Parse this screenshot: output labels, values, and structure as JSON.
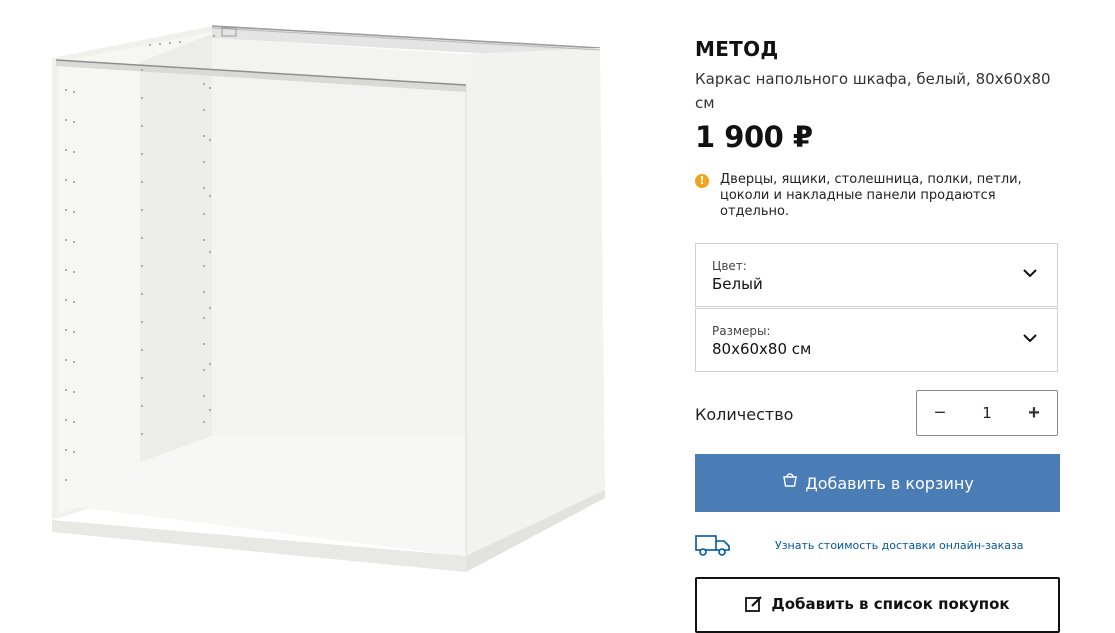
{
  "product": {
    "name": "МЕТОД",
    "description": "Каркас напольного шкафа, белый, 80x60x80 см",
    "price": "1 900 ₽",
    "notice_icon": "!",
    "notice": "Дверцы, ящики, столешница, полки, петли, цоколи и накладные панели продаются отдельно."
  },
  "options": {
    "color": {
      "label": "Цвет:",
      "value": "Белый"
    },
    "size": {
      "label": "Размеры:",
      "value": "80x60x80 см"
    }
  },
  "quantity": {
    "label": "Количество",
    "value": "1",
    "minus": "−",
    "plus": "+"
  },
  "actions": {
    "add_to_cart": "Добавить в корзину",
    "delivery_link": "Узнать стоимость доставки онлайн-заказа",
    "add_to_list": "Добавить в список покупок"
  },
  "colors": {
    "accent": "#4a7db6",
    "link": "#0058a3",
    "notice": "#f2a41c"
  },
  "icons": {
    "notice": "warning-icon",
    "select": "chevron-down-icon",
    "cart": "shopping-bag-icon",
    "delivery": "truck-icon",
    "list": "edit-list-icon"
  }
}
